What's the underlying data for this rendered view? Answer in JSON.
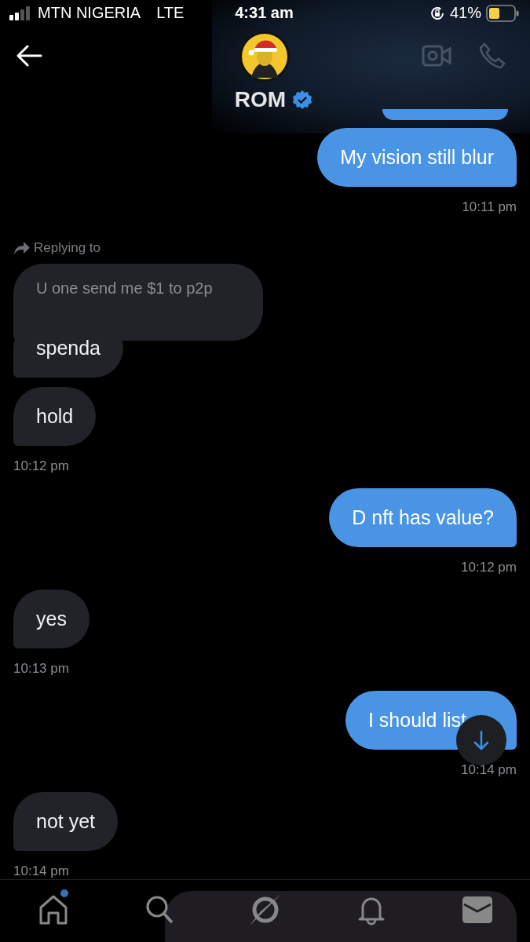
{
  "status_bar": {
    "carrier": "MTN NIGERIA",
    "network": "LTE",
    "time": "4:31 am",
    "battery": "41%"
  },
  "header": {
    "name": "ROM",
    "verified": true
  },
  "groups": [
    {
      "kind": "outgoing",
      "bubbles": [
        "My vision still blur"
      ],
      "time": "10:11 pm"
    },
    {
      "kind": "incoming",
      "reply_label": "Replying to",
      "quote": "U one send me  $1 to p2p",
      "bubbles": [
        "spenda",
        "hold"
      ],
      "time": "10:12 pm"
    },
    {
      "kind": "outgoing",
      "bubbles": [
        "D nft has value?"
      ],
      "time": "10:12 pm"
    },
    {
      "kind": "incoming",
      "bubbles": [
        "yes"
      ],
      "time": "10:13 pm"
    },
    {
      "kind": "outgoing",
      "bubbles": [
        "I should list"
      ],
      "time": "10:14 pm",
      "scroll_button": true
    },
    {
      "kind": "incoming",
      "bubbles": [
        "not yet"
      ],
      "time": "10:14 pm"
    }
  ],
  "tabs": [
    {
      "kind": "home",
      "selected": false,
      "badge": true
    },
    {
      "kind": "search",
      "selected": false,
      "badge": false
    },
    {
      "kind": "spaces",
      "selected": false,
      "badge": false
    },
    {
      "kind": "bell",
      "selected": false,
      "badge": false
    },
    {
      "kind": "mail",
      "selected": true,
      "badge": false
    }
  ]
}
